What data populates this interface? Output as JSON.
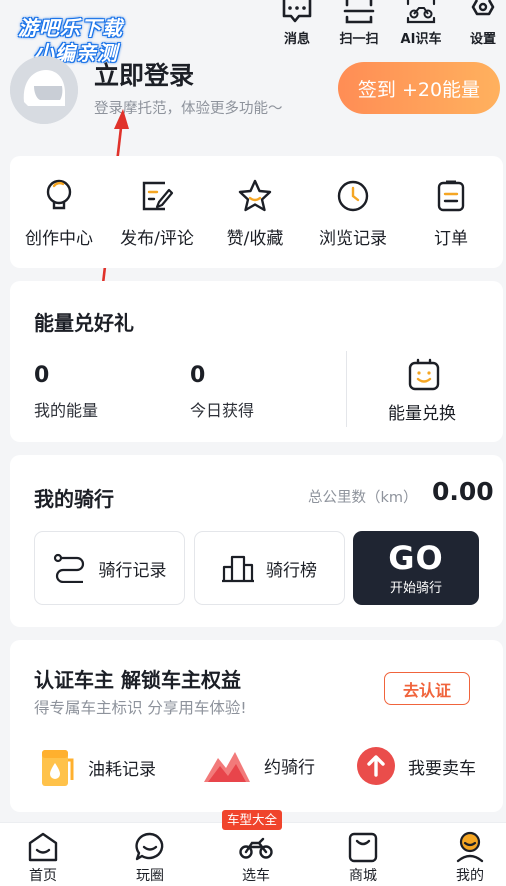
{
  "watermark": {
    "line1": "游吧乐下载",
    "line2": "小编亲测"
  },
  "top_icons": [
    {
      "label": "消息",
      "icon": "message-icon"
    },
    {
      "label": "扫一扫",
      "icon": "scan-icon"
    },
    {
      "label": "AI识车",
      "icon": "ai-motorcycle-icon"
    },
    {
      "label": "设置",
      "icon": "gear-icon"
    }
  ],
  "profile": {
    "title": "立即登录",
    "subtitle": "登录摩托范，体验更多功能～",
    "checkin_label": "签到 +20能量"
  },
  "quick_actions": [
    {
      "label": "创作中心",
      "icon": "lightbulb-icon"
    },
    {
      "label": "发布/评论",
      "icon": "edit-icon"
    },
    {
      "label": "赞/收藏",
      "icon": "star-icon"
    },
    {
      "label": "浏览记录",
      "icon": "clock-icon"
    },
    {
      "label": "订单",
      "icon": "order-icon"
    }
  ],
  "energy": {
    "title": "能量兑好礼",
    "my_energy_value": "0",
    "my_energy_label": "我的能量",
    "today_value": "0",
    "today_label": "今日获得",
    "exchange_label": "能量兑换"
  },
  "riding": {
    "title": "我的骑行",
    "total_label": "总公里数（km）",
    "total_value": "0.00",
    "record_label": "骑行记录",
    "rank_label": "骑行榜",
    "go_label": "GO",
    "go_sub": "开始骑行"
  },
  "owner": {
    "title": "认证车主 解锁车主权益",
    "subtitle": "得专属车主标识 分享用车体验!",
    "cert_button": "去认证",
    "services": [
      {
        "label": "油耗记录",
        "icon": "fuel-icon"
      },
      {
        "label": "约骑行",
        "icon": "mountain-icon"
      },
      {
        "label": "我要卖车",
        "icon": "sell-icon"
      }
    ]
  },
  "tabbar": {
    "badge": "车型大全",
    "tabs": [
      {
        "label": "首页",
        "icon": "home-icon"
      },
      {
        "label": "玩圈",
        "icon": "chat-bubble-icon"
      },
      {
        "label": "选车",
        "icon": "motorcycle-icon"
      },
      {
        "label": "商城",
        "icon": "shop-icon"
      },
      {
        "label": "我的",
        "icon": "profile-icon"
      }
    ]
  },
  "colors": {
    "accent": "#f0643c",
    "checkin_gradient_start": "#ff8d55",
    "checkin_gradient_end": "#ffb15e",
    "go_bg": "#1f2532",
    "icon_orange": "#f5a623"
  }
}
